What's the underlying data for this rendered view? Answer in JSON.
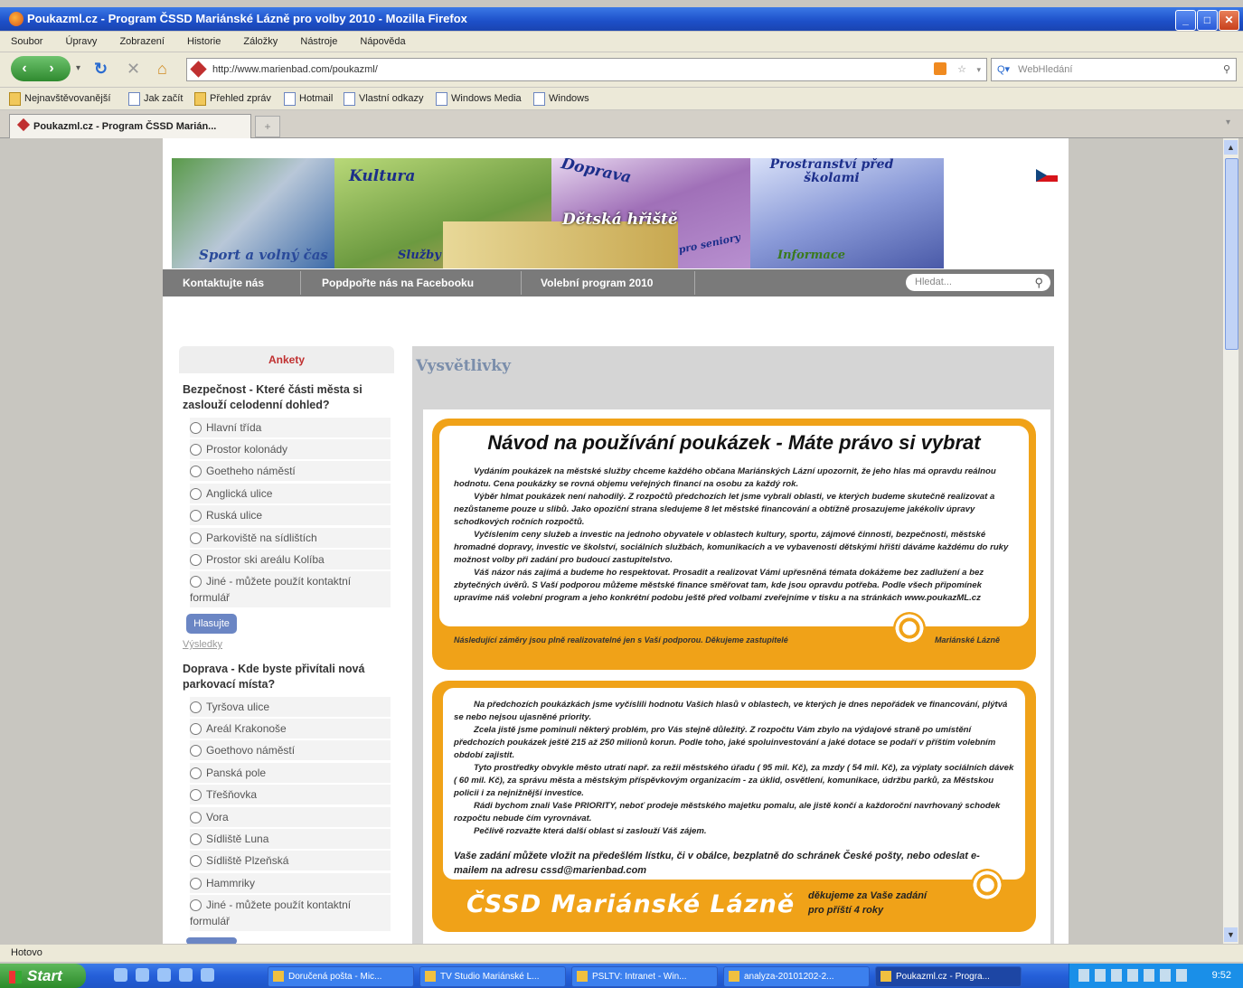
{
  "window": {
    "title": "Poukazml.cz - Program ČSSD Mariánské Lázně pro volby 2010 - Mozilla Firefox",
    "buttons": [
      "_",
      "□",
      "✕"
    ]
  },
  "menu": [
    "Soubor",
    "Úpravy",
    "Zobrazení",
    "Historie",
    "Záložky",
    "Nástroje",
    "Nápověda"
  ],
  "nav": {
    "url": "http://www.marienbad.com/poukazml/",
    "search_placeholder": "WebHledání"
  },
  "bookmarks": [
    "Nejnavštěvovanější",
    "Jak začít",
    "Přehled zpráv",
    "Hotmail",
    "Vlastní odkazy",
    "Windows Media",
    "Windows"
  ],
  "tab": {
    "label": "Poukazml.cz - Program ČSSD Marián..."
  },
  "page": {
    "banner_labels": [
      "Kultura",
      "Doprava",
      "Prostranství před školami",
      "Dětská hřiště",
      "Sport a volný čas",
      "Služby",
      "pro seniory",
      "Informace"
    ],
    "topnav": [
      "Kontaktujte nás",
      "Popdpořte nás na Facebooku",
      "Volební program 2010"
    ],
    "search_placeholder": "Hledat...",
    "sidebar": {
      "title": "Ankety",
      "q1": "Bezpečnost - Které části města si zaslouží celodenní dohled?",
      "q1_options": [
        "Hlavní třída",
        "Prostor kolonády",
        "Goetheho náměstí",
        "Anglická ulice",
        "Ruská ulice",
        "Parkoviště na sídlištích",
        "Prostor ski areálu Kolíba",
        "Jiné - můžete použít kontaktní formulář"
      ],
      "vote_label": "Hlasujte",
      "results_label": "Výsledky",
      "q2": "Doprava - Kde byste přivítali nová parkovací místa?",
      "q2_options": [
        "Tyršova ulice",
        "Areál Krakonoše",
        "Goethovo náměstí",
        "Panská pole",
        "Třešňovka",
        "Vora",
        "Sídliště Luna",
        "Sídliště Plzeňská",
        "Hammriky",
        "Jiné - můžete použít kontaktní formulář"
      ]
    },
    "main": {
      "title": "Vysvětlivky",
      "card1": {
        "heading": "Návod na používání poukázek - Máte právo si vybrat",
        "paragraphs": [
          "Vydáním poukázek na městské služby chceme každého občana Mariánských Lázní upozornit, že jeho hlas má opravdu reálnou hodnotu. Cena poukázky se rovná objemu veřejných financí na osobu za každý rok.",
          "Výběr hlmat poukázek není nahodilý. Z rozpočtů předchozích let jsme vybrali oblasti, ve kterých budeme skutečně realizovat a nezůstaneme pouze u slibů. Jako opoziční strana sledujeme 8 let městské financování a obtížně prosazujeme jakékoliv úpravy schodkových ročních rozpočtů.",
          "Vyčíslením ceny služeb a investic na jednoho obyvatele v oblastech kultury, sportu, zájmové činnosti, bezpečnosti, městské hromadné dopravy, investic ve školství, sociálních službách, komunikacích a ve vybavenosti dětskými hřišti dáváme každému do ruky možnost volby při zadání pro budoucí zastupitelstvo.",
          "Váš názor nás zajímá a budeme ho respektovat. Prosadit a realizovat Vámi upřesněná témata dokážeme bez zadlužení a bez zbytečných úvěrů. S Vaší podporou můžeme městské finance směřovat tam, kde jsou opravdu potřeba. Podle všech připomínek upravíme náš volební program a jeho konkrétní podobu ještě před volbami zveřejníme v tisku a na stránkách www.poukazML.cz"
        ],
        "footer_left": "Následující záměry jsou plně realizovatelné jen s Vaší podporou. Děkujeme zastupitelé",
        "footer_right": "Mariánské Lázně"
      },
      "card2": {
        "paragraphs": [
          "Na předchozích poukázkách jsme vyčíslili hodnotu Vašich hlasů v oblastech, ve kterých je dnes nepořádek ve financování, plýtvá se nebo nejsou ujasněné priority.",
          "Zcela jistě jsme pominuli některý problém, pro Vás stejně důležitý. Z rozpočtu Vám zbylo na výdajové straně po umístění předchozích poukázek ještě 215 až 250 milionů korun. Podle toho, jaké spoluinvestování a jaké dotace se podaří v příštím volebním období zajistit.",
          "Tyto prostředky obvykle město utratí např. za režii městského úřadu ( 95 mil. Kč), za mzdy ( 54 mil. Kč), za výplaty sociálních dávek ( 60 mil. Kč), za správu města a městským příspěvkovým organizacím - za úklid, osvětlení, komunikace, údržbu parků, za Městskou policii i za nejnižnější investice.",
          "Rádi bychom znali Vaše PRIORITY, neboť prodeje městského majetku pomalu, ale jistě končí a každoroční navrhovaný schodek rozpočtu nebude čím vyrovnávat.",
          "Pečlivě rozvažte která další oblast si zaslouží Váš zájem."
        ],
        "contact": "Vaše zadání můžete vložit na předešlém lístku, či v obálce, bezplatně do schránek České pošty, nebo odeslat e- mailem na adresu cssd@marienbad.com",
        "slogan": "ČSSD Mariánské Lázně",
        "thanks_line1": "děkujeme za Vaše zadání",
        "thanks_line2": "pro příští 4 roky"
      }
    }
  },
  "status": "Hotovo",
  "taskbar": {
    "start": "Start",
    "items": [
      "Doručená pošta - Mic...",
      "TV Studio Mariánské L...",
      "PSLTV: Intranet - Win...",
      "analyza-20101202-2...",
      "Poukazml.cz - Progra..."
    ],
    "clock": "9:52"
  }
}
